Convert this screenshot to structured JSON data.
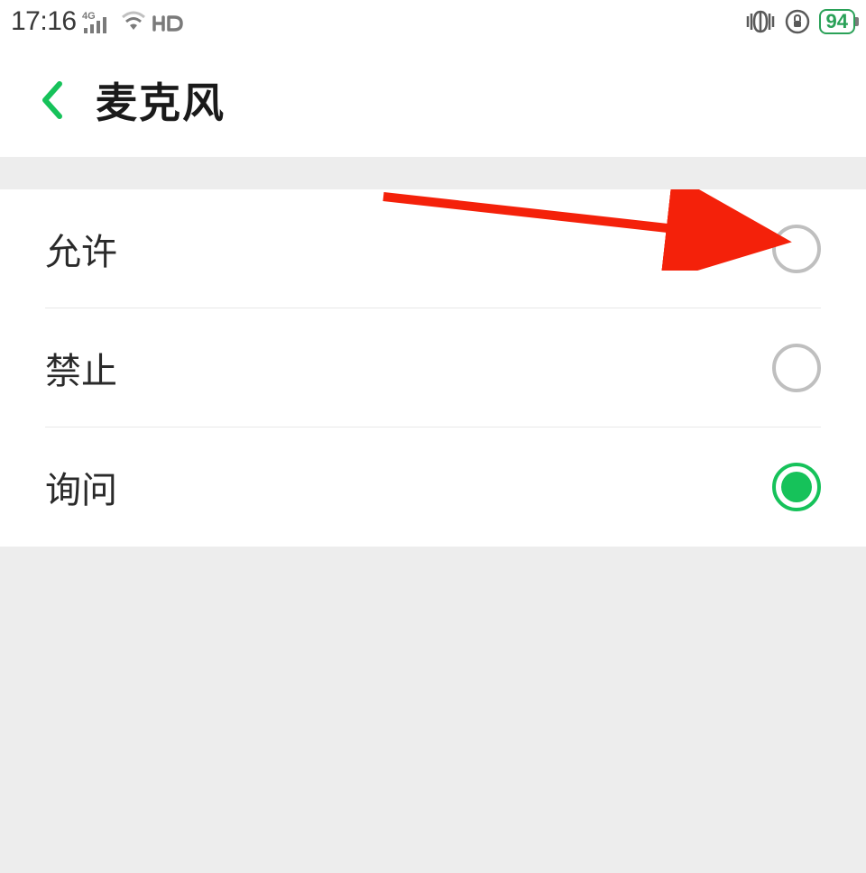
{
  "statusBar": {
    "time": "17:16",
    "signalLabel": "4G",
    "hdLabel": "HD",
    "batteryLevel": "94"
  },
  "header": {
    "title": "麦克风"
  },
  "options": {
    "0": {
      "label": "允许",
      "selected": false
    },
    "1": {
      "label": "禁止",
      "selected": false
    },
    "2": {
      "label": "询问",
      "selected": true
    }
  }
}
